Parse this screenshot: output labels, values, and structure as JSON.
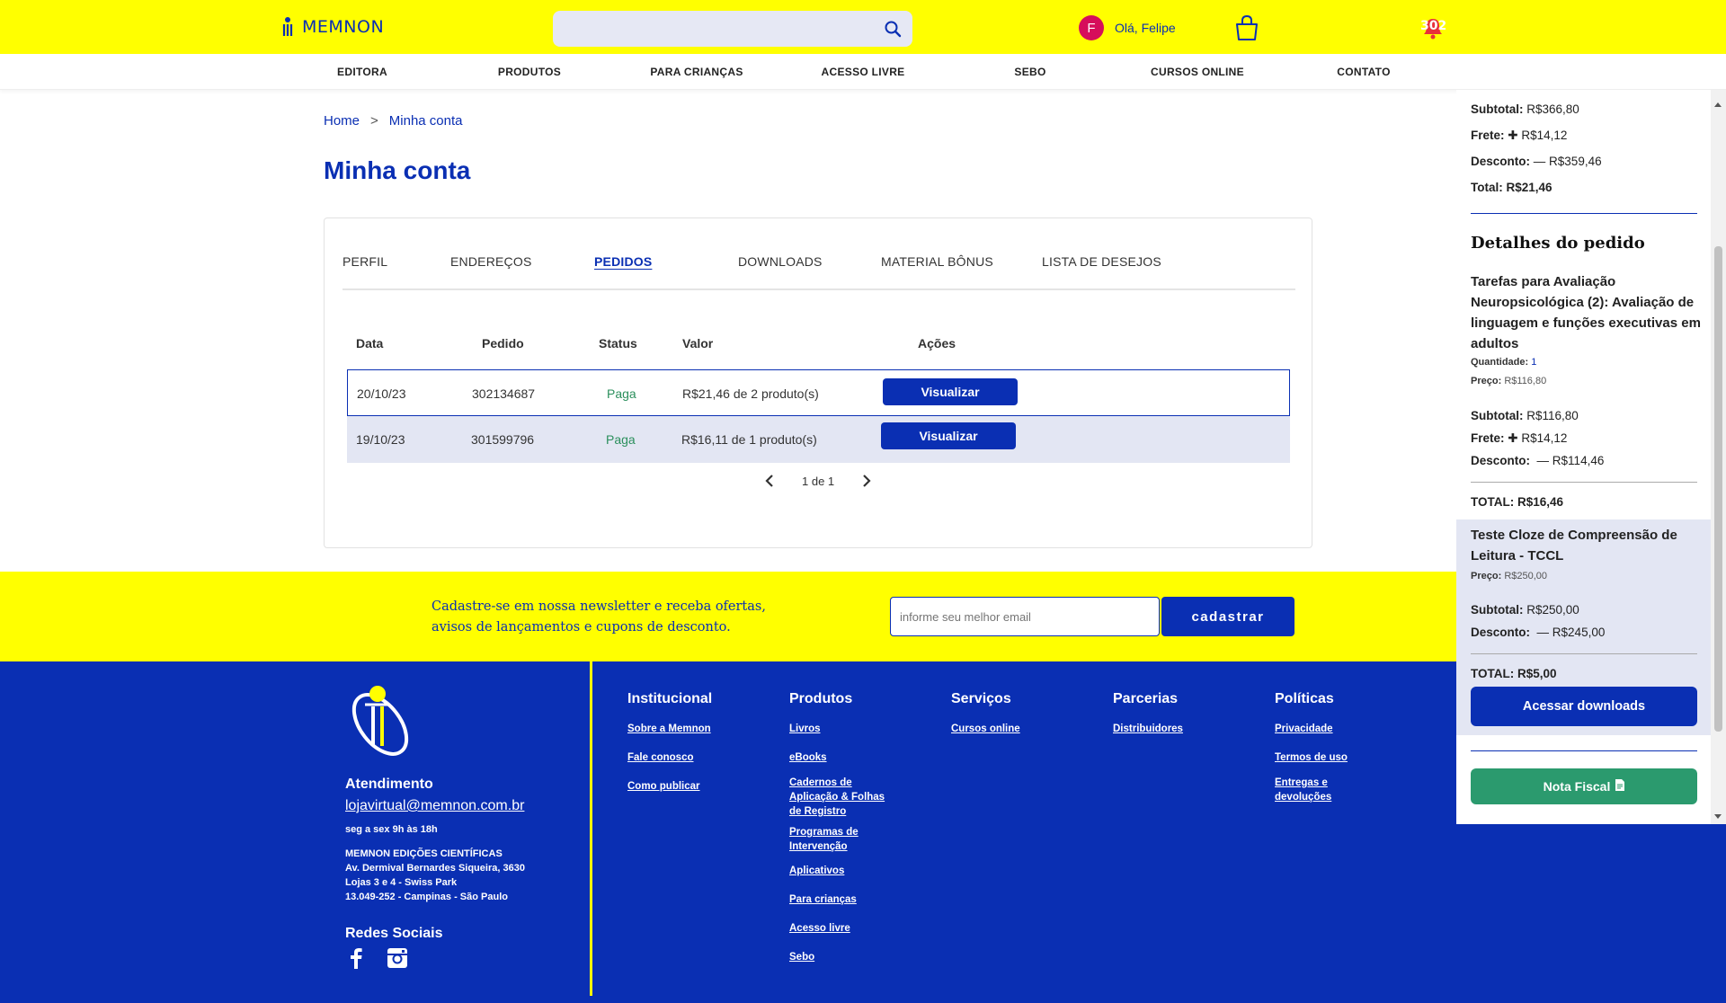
{
  "header": {
    "logo_text": "MEMNON",
    "search_placeholder": "",
    "avatar_initial": "F",
    "greeting": "Olá, Felipe",
    "notification_count": "302"
  },
  "nav": {
    "items": [
      "EDITORA",
      "PRODUTOS",
      "PARA CRIANÇAS",
      "ACESSO LIVRE",
      "SEBO",
      "CURSOS ONLINE",
      "CONTATO"
    ]
  },
  "breadcrumb": {
    "home": "Home",
    "separator": ">",
    "current": "Minha conta"
  },
  "page_title": "Minha conta",
  "tabs": [
    "PERFIL",
    "ENDEREÇOS",
    "PEDIDOS",
    "DOWNLOADS",
    "MATERIAL BÔNUS",
    "LISTA DE DESEJOS"
  ],
  "active_tab": "PEDIDOS",
  "orders": {
    "columns": [
      "Data",
      "Pedido",
      "Status",
      "Valor",
      "Ações"
    ],
    "rows": [
      {
        "date": "20/10/23",
        "order": "302134687",
        "status": "Paga",
        "value": "R$21,46 de 2 produto(s)",
        "action": "Visualizar"
      },
      {
        "date": "19/10/23",
        "order": "301599796",
        "status": "Paga",
        "value": "R$16,11 de 1 produto(s)",
        "action": "Visualizar"
      }
    ],
    "pagination": "1 de 1"
  },
  "newsletter": {
    "text_line1": "Cadastre-se em nossa newsletter e receba ofertas,",
    "text_line2": "avisos de lançamentos e cupons de desconto.",
    "input_placeholder": "informe seu melhor email",
    "button": "cadastrar"
  },
  "footer": {
    "atendimento_title": "Atendimento",
    "email": "lojavirtual@memnon.com.br",
    "hours": "seg a sex 9h às 18h",
    "address": [
      "MEMNON EDIÇÕES CIENTÍFICAS",
      "Av. Dermival Bernardes Siqueira, 3630",
      "Lojas 3 e 4 - Swiss Park",
      "13.049-252 - Campinas - São Paulo"
    ],
    "social_title": "Redes Sociais",
    "columns": [
      {
        "title": "Institucional",
        "links": [
          "Sobre a Memnon",
          "Fale conosco",
          "Como publicar"
        ]
      },
      {
        "title": "Produtos",
        "links": [
          "Livros",
          "eBooks",
          "Cadernos de Aplicação & Folhas de Registro",
          "Programas de Intervenção",
          "Aplicativos",
          "Para crianças",
          "Acesso livre",
          "Sebo"
        ]
      },
      {
        "title": "Serviços",
        "links": [
          "Cursos online"
        ]
      },
      {
        "title": "Parcerias",
        "links": [
          "Distribuidores"
        ]
      },
      {
        "title": "Políticas",
        "links": [
          "Privacidade",
          "Termos de uso",
          "Entregas e devoluções"
        ]
      }
    ]
  },
  "order_panel": {
    "summary": {
      "subtotal_label": "Subtotal:",
      "subtotal": "R$366,80",
      "frete_label": "Frete:",
      "frete": "R$14,12",
      "desconto_label": "Desconto:",
      "desconto": "R$359,46",
      "total_label": "Total:",
      "total": "R$21,46"
    },
    "details_title": "Detalhes do pedido",
    "items": [
      {
        "name": "Tarefas para Avaliação Neuropsicológica (2): Avaliação de linguagem e funções executivas em adultos",
        "qty_label": "Quantidade:",
        "qty": "1",
        "price_label": "Preço:",
        "price": "R$116,80",
        "subtotal": "R$116,80",
        "frete": "R$14,12",
        "desconto": "R$114,46",
        "total_label": "TOTAL:",
        "total": "R$16,46"
      },
      {
        "name": "Teste Cloze de Compreensão de Leitura - TCCL",
        "price_label": "Preço:",
        "price": "R$250,00",
        "subtotal": "R$250,00",
        "desconto": "R$245,00",
        "total_label": "TOTAL:",
        "total": "R$5,00"
      }
    ],
    "downloads_button": "Acessar downloads",
    "invoice_button": "Nota Fiscal"
  },
  "colors": {
    "brand_yellow": "#ffff00",
    "brand_blue": "#0a2fb3",
    "status_paid": "#2b8f5c",
    "invoice_green": "#2b9a6e",
    "avatar": "#d60e5b"
  }
}
